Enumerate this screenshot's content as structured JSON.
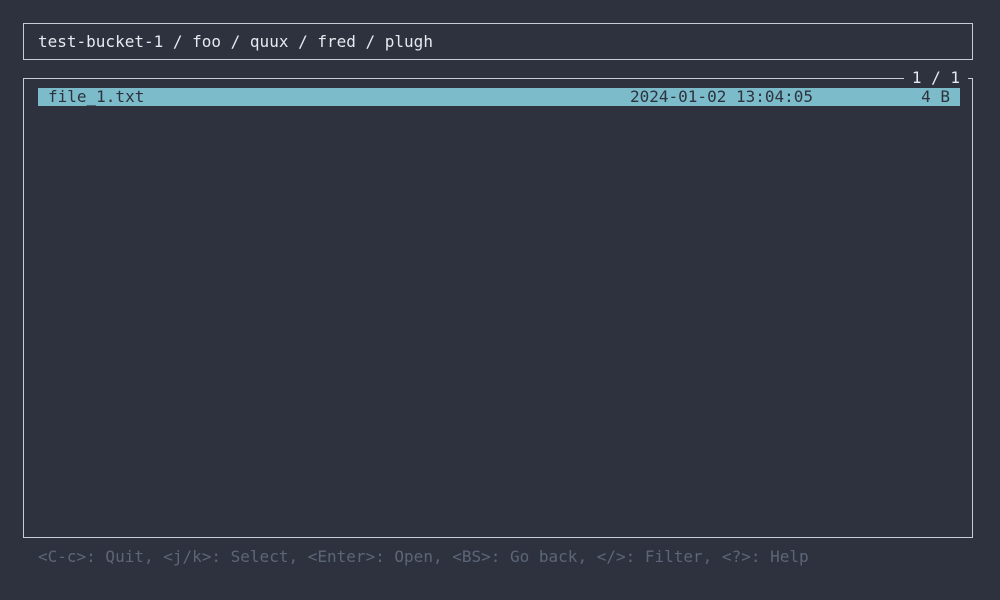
{
  "breadcrumb": {
    "path": "test-bucket-1 / foo / quux / fred / plugh"
  },
  "list": {
    "page_counter": "1 / 1",
    "rows": [
      {
        "name": "file_1.txt",
        "modified": "2024-01-02 13:04:05",
        "size": "4 B",
        "selected": true
      }
    ]
  },
  "help": {
    "text": "<C-c>: Quit, <j/k>: Select, <Enter>: Open, <BS>: Go back, </>: Filter, <?>: Help"
  },
  "colors": {
    "background": "#2e323e",
    "border": "#c7ccd6",
    "selection": "#7cbcca",
    "help_text": "#5d6677"
  }
}
